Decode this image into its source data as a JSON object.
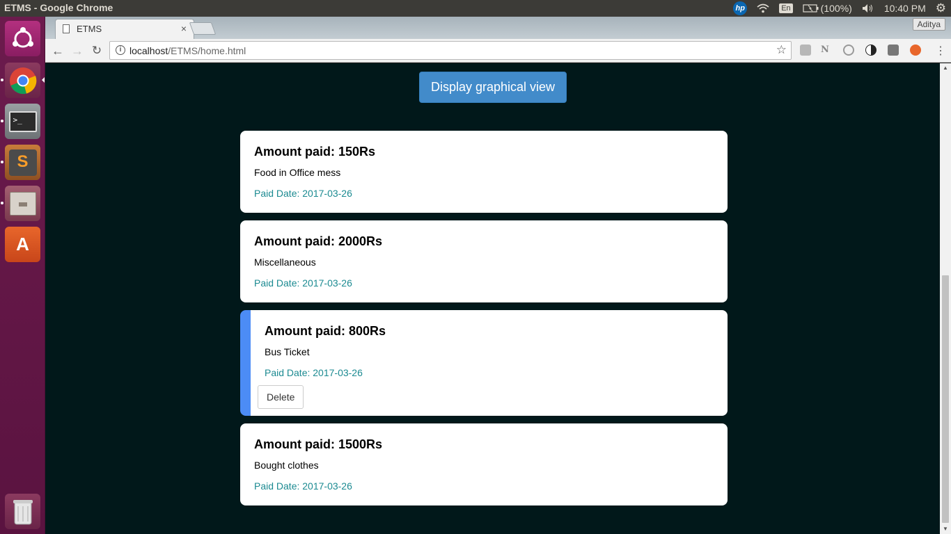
{
  "os_panel": {
    "window_title": "ETMS - Google Chrome",
    "keyboard": "En",
    "battery": "(100%)",
    "clock": "10:40 PM"
  },
  "launcher": {
    "items": [
      "ubuntu-dash",
      "chrome",
      "terminal",
      "sublime-text",
      "files",
      "software-center",
      "trash"
    ]
  },
  "browser": {
    "tab_title": "ETMS",
    "tab_close": "×",
    "profile_name": "Aditya",
    "url_host": "localhost",
    "url_path": "/ETMS/home.html"
  },
  "page": {
    "graph_button_label": "Display graphical view",
    "expenses": [
      {
        "amount": "Amount paid: 150Rs",
        "description": "Food in Office mess",
        "date": "Paid Date: 2017-03-26"
      },
      {
        "amount": "Amount paid: 2000Rs",
        "description": "Miscellaneous",
        "date": "Paid Date: 2017-03-26"
      },
      {
        "amount": "Amount paid: 800Rs",
        "description": "Bus Ticket",
        "date": "Paid Date: 2017-03-26",
        "delete_label": "Delete"
      },
      {
        "amount": "Amount paid: 1500Rs",
        "description": "Bought clothes",
        "date": "Paid Date: 2017-03-26"
      }
    ]
  },
  "colors": {
    "page_background": "#01181a",
    "primary_button": "#428bca",
    "date_text": "#1b8a91",
    "active_accent": "#4c8cf5"
  }
}
